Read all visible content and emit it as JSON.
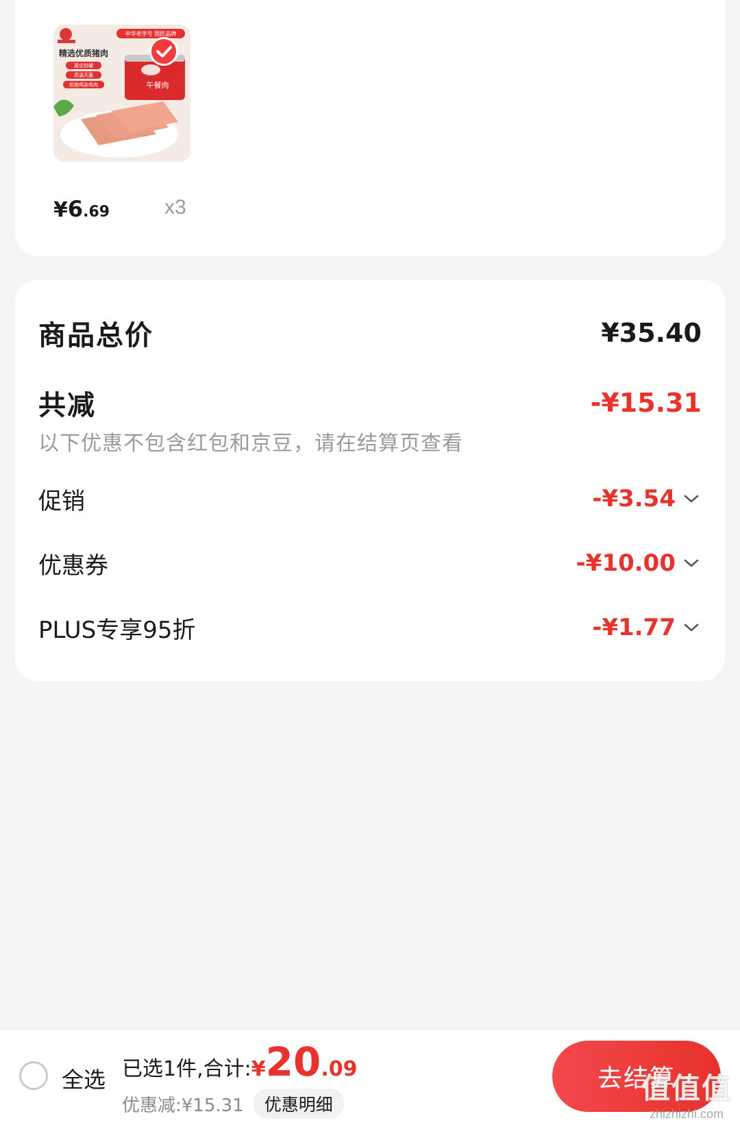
{
  "product": {
    "image_texts": {
      "brand_banner": "中华老字号 国民品牌",
      "headline": "精选优质猪肉",
      "tag_1": "真空封罐",
      "tag_2": "高温灭菌",
      "tag_3": "拒绝鸡杂鸡肉",
      "can_label": "午餐肉"
    },
    "price_currency": "¥",
    "price_integer": "6",
    "price_decimal": ".69",
    "quantity": "x3",
    "selected": true
  },
  "summary": {
    "total_label": "商品总价",
    "total_amount": "¥35.40",
    "reduce_label": "共减",
    "reduce_amount": "-¥15.31",
    "reduce_note": "以下优惠不包含红包和京豆，请在结算页查看",
    "discounts": [
      {
        "label": "促销",
        "amount": "-¥3.54"
      },
      {
        "label": "优惠券",
        "amount": "-¥10.00"
      },
      {
        "label": "PLUS专享95折",
        "amount": "-¥1.77"
      }
    ]
  },
  "bottom_bar": {
    "select_all_label": "全选",
    "selected_text": "已选1件,合计:",
    "total_currency": "¥",
    "total_integer": "20",
    "total_decimal": ".09",
    "discount_text": "优惠减:¥15.31",
    "discount_detail_label": "优惠明细",
    "checkout_label": "去结算"
  },
  "watermark": {
    "main": "值值值",
    "sub": "zhizhizhi.com"
  },
  "colors": {
    "accent_red": "#e8322b",
    "background": "#f5f5f5",
    "card": "#ffffff",
    "muted_text": "#9a9a9a"
  }
}
